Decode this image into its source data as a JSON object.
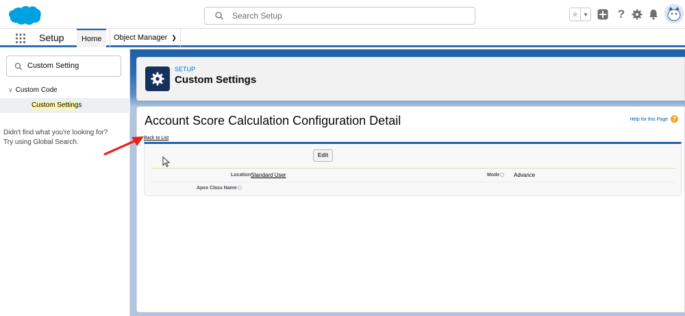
{
  "header": {
    "search_placeholder": "Search Setup"
  },
  "context_bar": {
    "app_name": "Setup",
    "tabs": [
      {
        "label": "Home"
      },
      {
        "label": "Object Manager"
      }
    ]
  },
  "sidebar": {
    "quick_find_value": "Custom Setting",
    "tree_parent": "Custom Code",
    "tree_child_prefix": "Custom Setting",
    "tree_child_suffix": "s",
    "help_line1": "Didn't find what you're looking for?",
    "help_line2": "Try using Global Search."
  },
  "page_header": {
    "label": "SETUP",
    "title": "Custom Settings"
  },
  "detail": {
    "title": "Account Score Calculation Configuration Detail",
    "help_link": "Help for this Page",
    "back_link": "Back to List",
    "edit_label": "Edit",
    "fields": {
      "location_label": "Location",
      "location_value": "Standard User",
      "mode_label": "Mode",
      "mode_value": "Advance",
      "apex_label": "Apex Class Name",
      "apex_value": ""
    }
  },
  "colors": {
    "brand_blue": "#0070d2",
    "header_navy": "#16325c",
    "annotation_red": "#e8221b",
    "highlight_yellow": "#fbf8a9"
  }
}
